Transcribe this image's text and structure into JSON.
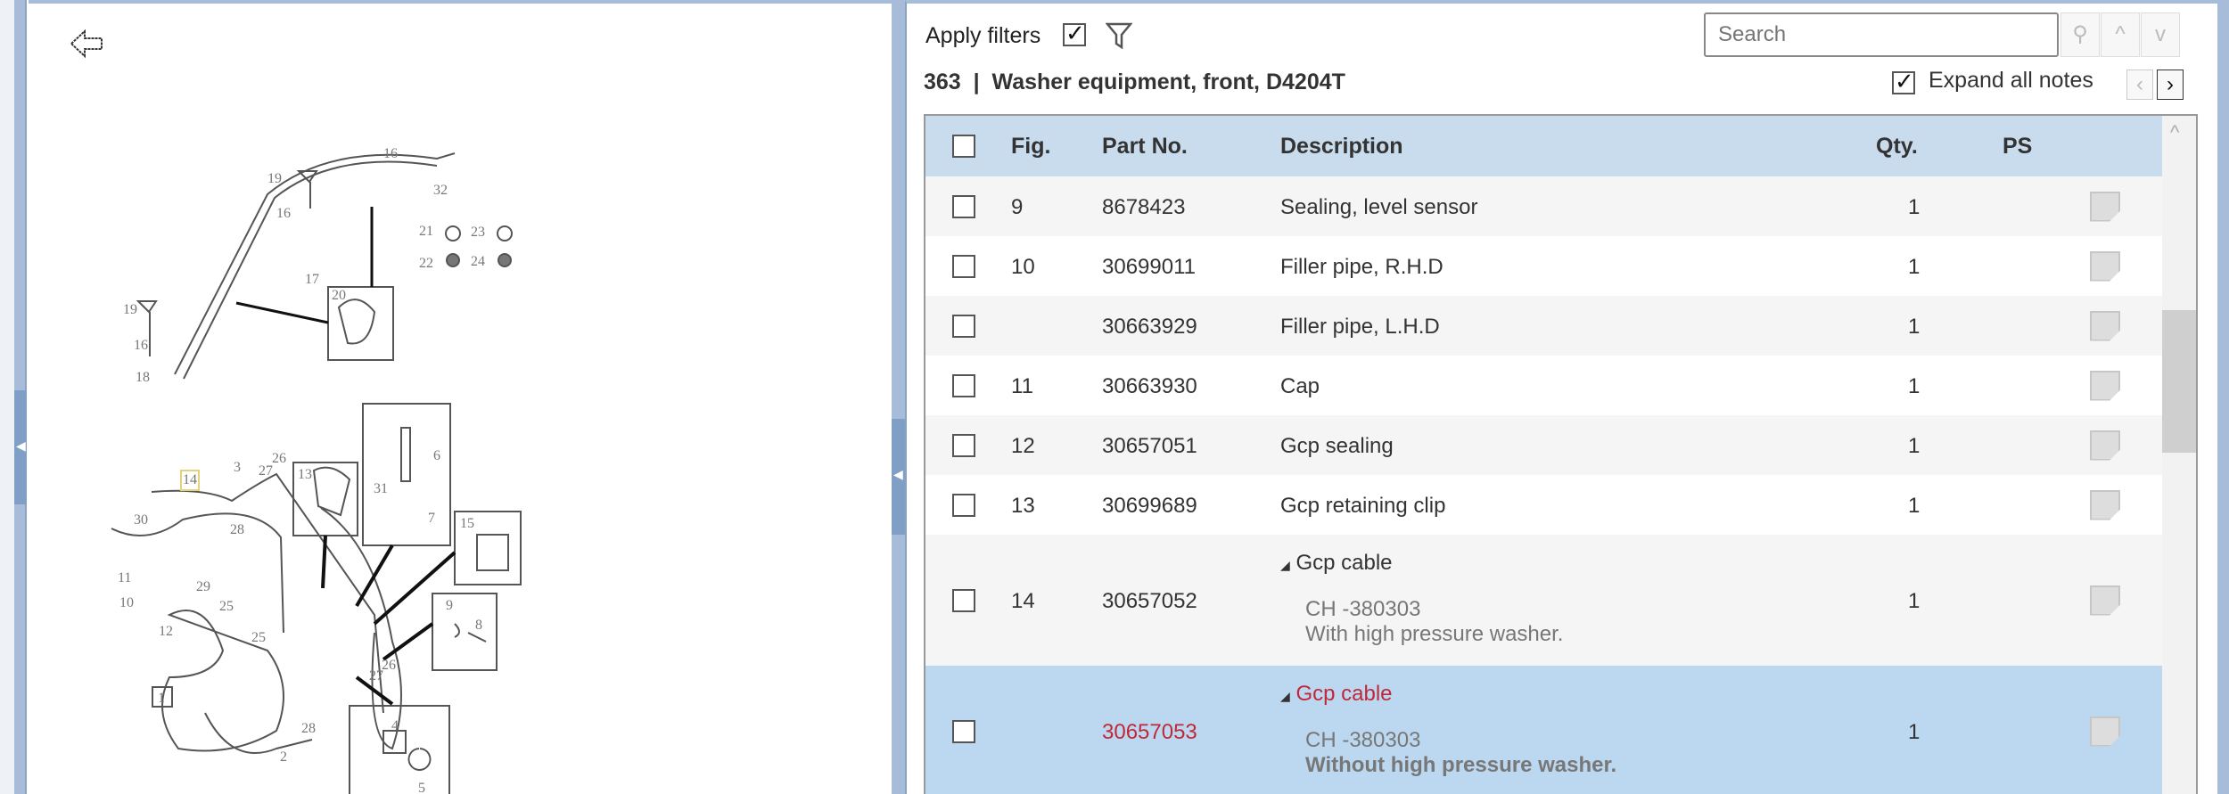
{
  "toolbar": {
    "apply_filters": "Apply filters",
    "apply_filters_checked": true,
    "search_placeholder": "Search",
    "search_icon": "magnifier",
    "up": "^",
    "down": "v"
  },
  "header": {
    "group_no": "363",
    "separator": "|",
    "title": "Washer equipment, front, D4204T",
    "expand_all_notes": "Expand all notes",
    "expand_checked": true,
    "prev": "‹",
    "next": "›"
  },
  "table": {
    "columns": {
      "fig": "Fig.",
      "part_no": "Part No.",
      "description": "Description",
      "qty": "Qty.",
      "ps": "PS"
    },
    "rows": [
      {
        "fig": "9",
        "part_no": "8678423",
        "description": "Sealing, level sensor",
        "qty": "1"
      },
      {
        "fig": "10",
        "part_no": "30699011",
        "description": "Filler pipe, R.H.D",
        "qty": "1"
      },
      {
        "fig": "",
        "part_no": "30663929",
        "description": "Filler pipe, L.H.D",
        "qty": "1"
      },
      {
        "fig": "11",
        "part_no": "30663930",
        "description": "Cap",
        "qty": "1"
      },
      {
        "fig": "12",
        "part_no": "30657051",
        "description": "Gcp sealing",
        "qty": "1"
      },
      {
        "fig": "13",
        "part_no": "30699689",
        "description": "Gcp retaining clip",
        "qty": "1"
      },
      {
        "fig": "14",
        "part_no": "30657052",
        "description": "Gcp cable",
        "note_code": "CH -380303",
        "note": "With high pressure washer.",
        "qty": "1"
      },
      {
        "fig": "",
        "part_no": "30657053",
        "description": "Gcp cable",
        "note_code": "CH -380303",
        "note": "Without high pressure washer.",
        "qty": "1",
        "selected": true
      }
    ]
  },
  "colors": {
    "selected_row": "#bcd8f0",
    "header_bg": "#c9dced",
    "highlight_text": "#c0283a",
    "panel_border": "#a6bcd8"
  },
  "diagram": {
    "callouts": [
      "19",
      "16",
      "17",
      "16",
      "32",
      "21",
      "23",
      "22",
      "24",
      "20",
      "19",
      "16",
      "18",
      "14",
      "3",
      "27",
      "26",
      "30",
      "28",
      "11",
      "29",
      "10",
      "25",
      "12",
      "25",
      "1",
      "2",
      "28",
      "26",
      "27",
      "13",
      "31",
      "6",
      "7",
      "15",
      "9",
      "8",
      "4",
      "5"
    ]
  }
}
